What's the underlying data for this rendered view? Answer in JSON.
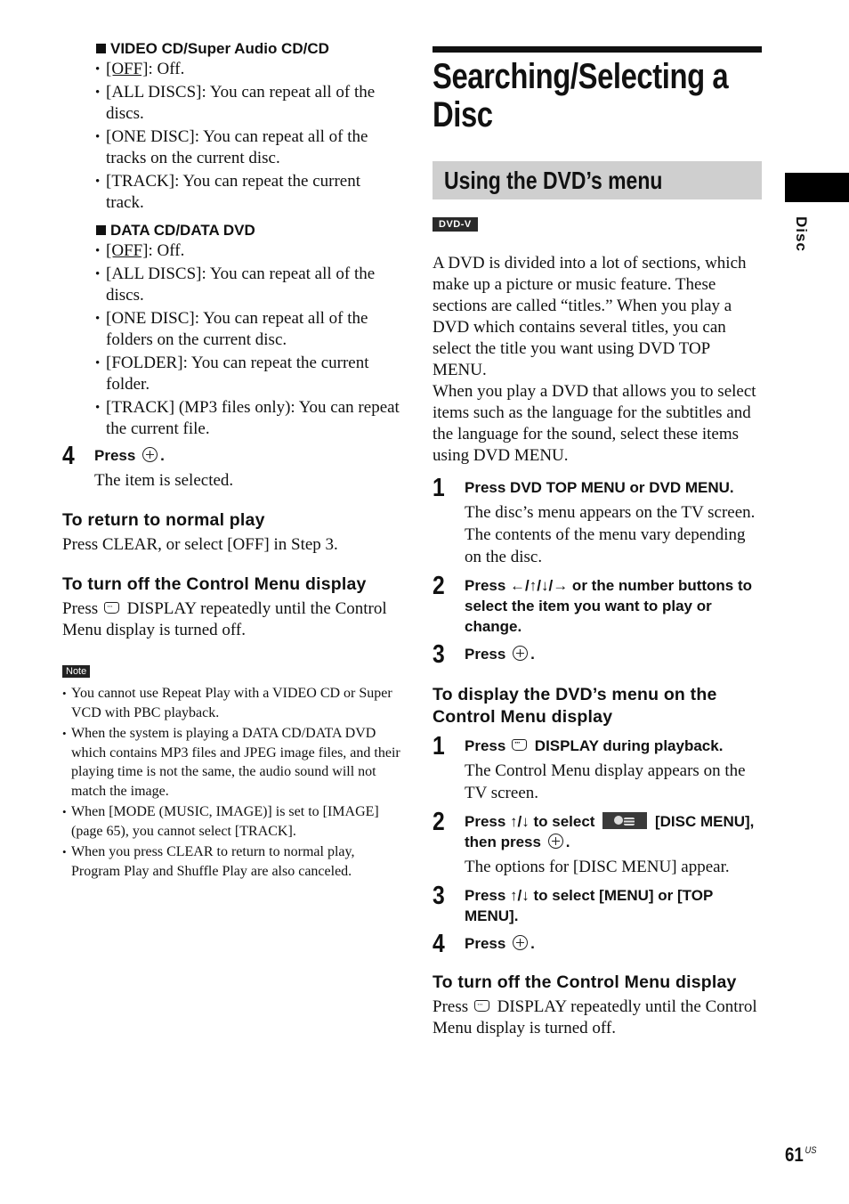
{
  "left": {
    "groups": [
      {
        "heading": "VIDEO CD/Super Audio CD/CD",
        "options": [
          {
            "key": "[OFF]",
            "text": ": Off.",
            "underlined": true
          },
          {
            "key": "[ALL DISCS]",
            "text": ": You can repeat all of the discs.",
            "underlined": false
          },
          {
            "key": "[ONE DISC]",
            "text": ": You can repeat all of the tracks on the current disc.",
            "underlined": false
          },
          {
            "key": "[TRACK]",
            "text": ": You can repeat the current track.",
            "underlined": false
          }
        ]
      },
      {
        "heading": "DATA CD/DATA DVD",
        "options": [
          {
            "key": "[OFF]",
            "text": ": Off.",
            "underlined": true
          },
          {
            "key": "[ALL DISCS]",
            "text": ": You can repeat all of the discs.",
            "underlined": false
          },
          {
            "key": "[ONE DISC]",
            "text": ": You can repeat all of the folders on the current disc.",
            "underlined": false
          },
          {
            "key": "[FOLDER]",
            "text": ": You can repeat the current folder.",
            "underlined": false
          },
          {
            "key": "[TRACK]",
            "text": " (MP3 files only): You can repeat the current file.",
            "underlined": false
          }
        ]
      }
    ],
    "step4": {
      "num": "4",
      "title_pre": "Press",
      "title_post": ".",
      "icon": "enter-button-icon",
      "body": "The item is selected."
    },
    "return_normal": {
      "heading": "To return to normal play",
      "body": "Press CLEAR, or select [OFF] in Step 3."
    },
    "turn_off": {
      "heading": "To turn off the Control Menu display",
      "pre": "Press",
      "icon": "display-button-icon",
      "post": "DISPLAY repeatedly until the Control Menu display is turned off."
    },
    "note": {
      "label": "Note",
      "items": [
        "You cannot use Repeat Play with a VIDEO CD or Super VCD with PBC playback.",
        "When the system is playing a DATA CD/DATA DVD which contains MP3 files and JPEG image files, and their playing time is not the same, the audio sound will not match the image.",
        "When [MODE (MUSIC, IMAGE)] is set to [IMAGE] (page 65), you cannot select [TRACK].",
        "When you press CLEAR to return to normal play, Program Play and Shuffle Play are also canceled."
      ]
    }
  },
  "right": {
    "title": "Searching/Selecting a Disc",
    "section": "Using the DVD’s menu",
    "badge": "DVD-V",
    "intro1": "A DVD is divided into a lot of sections, which make up a picture or music feature. These sections are called “titles.” When you play a DVD which contains several titles, you can select the title you want using DVD TOP MENU.",
    "intro2": "When you play a DVD that allows you to select items such as the language for the subtitles and the language for the sound, select these items using DVD MENU.",
    "steps": [
      {
        "num": "1",
        "title": "Press DVD TOP MENU or DVD MENU.",
        "body": "The disc’s menu appears on the TV screen. The contents of the menu vary depending on the disc."
      },
      {
        "num": "2",
        "title": "Press ←/↑/↓/→ or the number buttons to select the item you want to play or change."
      },
      {
        "num": "3",
        "title_pre": "Press",
        "title_post": "."
      }
    ],
    "control_menu": {
      "heading": "To display the DVD’s menu on the Control Menu display",
      "steps": [
        {
          "num": "1",
          "title_pre": "Press",
          "title_post": "DISPLAY during playback.",
          "body": "The Control Menu display appears on the TV screen."
        },
        {
          "num": "2",
          "title_pre": "Press ↑/↓ to select",
          "title_mid": "[DISC MENU], then press",
          "title_post": ".",
          "body": "The options for [DISC MENU] appear."
        },
        {
          "num": "3",
          "title": "Press ↑/↓ to select [MENU] or [TOP MENU]."
        },
        {
          "num": "4",
          "title_pre": "Press",
          "title_post": "."
        }
      ]
    },
    "turn_off": {
      "heading": "To turn off the Control Menu display",
      "pre": "Press",
      "post": "DISPLAY repeatedly until the Control Menu display is turned off."
    }
  },
  "side_tab": {
    "label": "Disc"
  },
  "footer": {
    "page_number": "61",
    "region": "US"
  }
}
